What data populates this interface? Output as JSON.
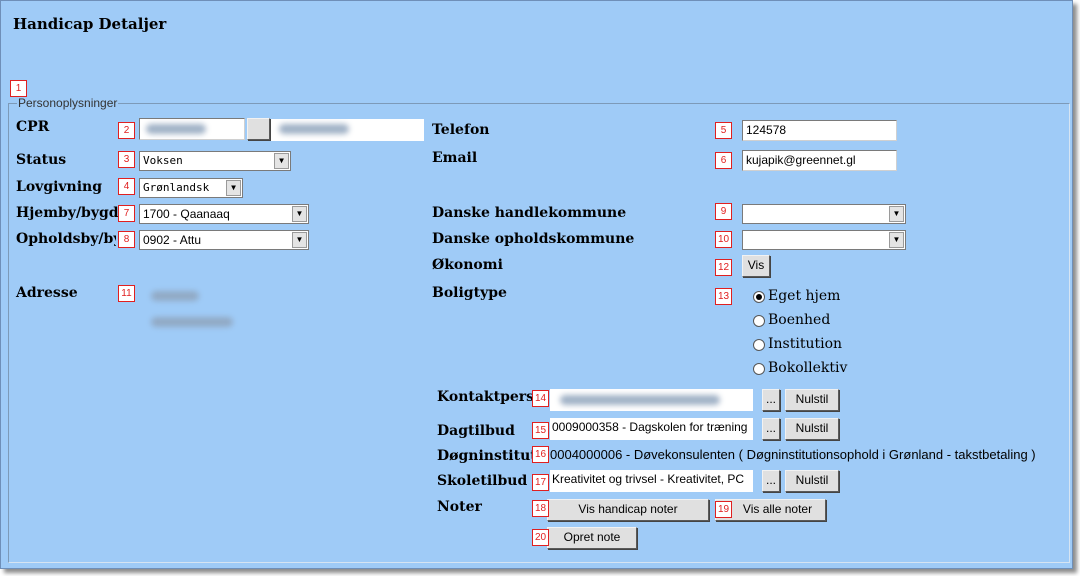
{
  "page_title": "Handicap Detaljer",
  "fieldset_legend": "Personoplysninger",
  "markers": [
    "1",
    "2",
    "3",
    "4",
    "5",
    "6",
    "7",
    "8",
    "9",
    "10",
    "11",
    "12",
    "13",
    "14",
    "15",
    "16",
    "17",
    "18",
    "19",
    "20"
  ],
  "left": {
    "cpr_label": "CPR",
    "status_label": "Status",
    "status_value": "Voksen",
    "lovgivning_label": "Lovgivning",
    "lovgivning_value": "Grønlandsk",
    "hjemby_label": "Hjemby/bygde",
    "hjemby_value": "1700 - Qaanaaq",
    "opholdsby_label": "Opholdsby/bygde",
    "opholdsby_value": "0902 - Attu",
    "adresse_label": "Adresse"
  },
  "right": {
    "telefon_label": "Telefon",
    "telefon_value": "124578",
    "email_label": "Email",
    "email_value": "kujapik@greennet.gl",
    "handlekommune_label": "Danske handlekommune",
    "handlekommune_value": "",
    "opholdskommune_label": "Danske opholdskommune",
    "opholdskommune_value": "",
    "okonomi_label": "Økonomi",
    "vis_button": "Vis",
    "boligtype_label": "Boligtype",
    "boligtype_options": [
      "Eget hjem",
      "Boenhed",
      "Institution",
      "Bokollektiv"
    ],
    "boligtype_selected": "Eget hjem"
  },
  "bottom": {
    "kontaktperson_label": "Kontaktperson",
    "dagtilbud_label": "Dagtilbud",
    "dagtilbud_value": "0009000358 - Dagskolen for træning",
    "dogninstitution_label": "Døgninstitution",
    "dogninstitution_value": "0004000006 - Døvekonsulenten ( Døgninstitutionsophold i Grønland - takstbetaling )",
    "skoletilbud_label": "Skoletilbud",
    "skoletilbud_value": "Kreativitet og trivsel - Kreativitet, PC",
    "noter_label": "Noter",
    "browse_button": "...",
    "nulstil_button": "Nulstil",
    "vis_handicap_noter": "Vis handicap noter",
    "vis_alle_noter": "Vis alle noter",
    "opret_note": "Opret note"
  }
}
